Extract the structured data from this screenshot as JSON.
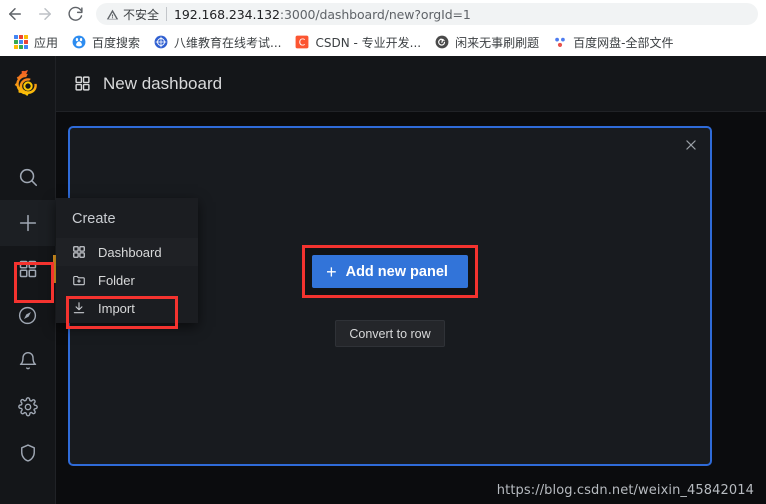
{
  "browser": {
    "nav": {
      "back": "back-arrow",
      "forward": "forward-arrow",
      "reload": "reload"
    },
    "omnibox": {
      "security_icon": "warning-triangle-icon",
      "security_label": "不安全",
      "url_host": "192.168.234.132",
      "url_rest": ":3000/dashboard/new?orgId=1",
      "full_url": "192.168.234.132:3000/dashboard/new?orgId=1"
    },
    "bookmarks": [
      {
        "label": "应用",
        "icon": "apps-grid-icon",
        "color": "#4285f4"
      },
      {
        "label": "百度搜索",
        "icon": "baidu-icon",
        "color": "#2d8cf0"
      },
      {
        "label": "八维教育在线考试...",
        "icon": "globe-icon",
        "color": "#2f5fd0"
      },
      {
        "label": "CSDN - 专业开发...",
        "icon": "csdn-icon",
        "color": "#fc5531"
      },
      {
        "label": "闲来无事刷刷题",
        "icon": "circle-arrow-icon",
        "color": "#4a4a4a"
      },
      {
        "label": "百度网盘-全部文件",
        "icon": "baidu-pan-icon",
        "color": "#4e7cf0"
      }
    ]
  },
  "grafana": {
    "brand_icon": "grafana-logo",
    "header": {
      "title_icon": "dashboard-grid-icon",
      "title": "New dashboard"
    },
    "sidebar": {
      "items": [
        {
          "name": "search",
          "icon": "search-icon",
          "active": false,
          "accent": false
        },
        {
          "name": "create",
          "icon": "plus-icon",
          "active": true,
          "accent": false
        },
        {
          "name": "dashboards",
          "icon": "dashboard-grid-icon",
          "active": false,
          "accent": true
        },
        {
          "name": "explore",
          "icon": "compass-icon",
          "active": false,
          "accent": false
        },
        {
          "name": "alerting",
          "icon": "bell-icon",
          "active": false,
          "accent": false
        },
        {
          "name": "configuration",
          "icon": "gear-icon",
          "active": false,
          "accent": false
        },
        {
          "name": "server-admin",
          "icon": "shield-icon",
          "active": false,
          "accent": false
        }
      ]
    },
    "create_menu": {
      "heading": "Create",
      "items": [
        {
          "label": "Dashboard",
          "icon": "dashboard-grid-icon",
          "selected": true
        },
        {
          "label": "Folder",
          "icon": "folder-plus-icon",
          "selected": false
        },
        {
          "label": "Import",
          "icon": "import-download-icon",
          "selected": false
        }
      ]
    },
    "panel": {
      "close_icon": "close-x-icon",
      "add_panel_label": "Add new panel",
      "add_panel_plus": "+",
      "convert_label": "Convert to row",
      "border_color": "#2f6bd8",
      "primary_button_color": "#3274d9"
    },
    "annotations": {
      "highlight_color": "#f4332f",
      "targets": [
        "create-sidebar-button",
        "dashboard-menu-item",
        "add-new-panel-button"
      ]
    },
    "watermark": "https://blog.csdn.net/weixin_45842014"
  }
}
